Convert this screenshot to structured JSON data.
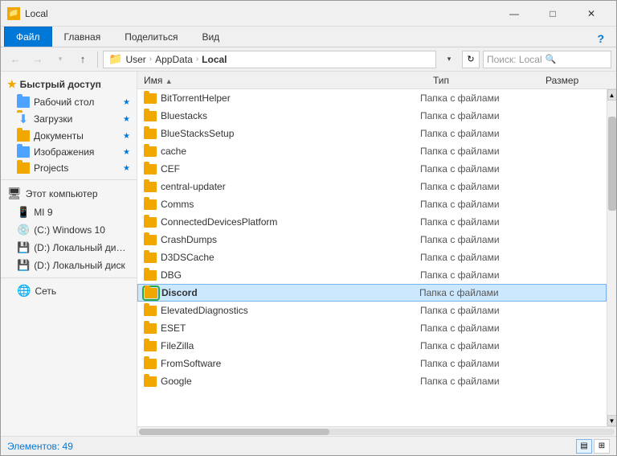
{
  "window": {
    "title": "Local",
    "title_icon": "📁"
  },
  "ribbon": {
    "tabs": [
      {
        "label": "Файл",
        "active": true
      },
      {
        "label": "Главная",
        "active": false
      },
      {
        "label": "Поделиться",
        "active": false
      },
      {
        "label": "Вид",
        "active": false
      }
    ]
  },
  "toolbar": {
    "back_label": "←",
    "forward_label": "→",
    "up_label": "↑",
    "refresh_label": "↺"
  },
  "address": {
    "crumbs": [
      "User",
      "AppData",
      "Local"
    ],
    "search_placeholder": "Поиск: Local"
  },
  "sidebar": {
    "quick_access_label": "Быстрый доступ",
    "items": [
      {
        "label": "Рабочий стол",
        "badge": "★"
      },
      {
        "label": "Загрузки",
        "badge": "↓"
      },
      {
        "label": "Документы",
        "badge": "★"
      },
      {
        "label": "Изображения",
        "badge": "★"
      },
      {
        "label": "Projects",
        "badge": "★"
      }
    ],
    "computer_label": "Этот компьютер",
    "drives": [
      {
        "label": "MI 9"
      },
      {
        "label": "(C:) Windows 10"
      },
      {
        "label": "(D:) Локальный ди…"
      },
      {
        "label": "(D:) Локальный диск"
      }
    ],
    "network_label": "Сеть"
  },
  "file_list": {
    "columns": {
      "name": "Имя",
      "type": "Тип",
      "size": "Размер"
    },
    "files": [
      {
        "name": "BitTorrentHelper",
        "type": "Папка с файлами",
        "size": ""
      },
      {
        "name": "Bluestacks",
        "type": "Папка с файлами",
        "size": ""
      },
      {
        "name": "BlueStacksSetup",
        "type": "Папка с файлами",
        "size": ""
      },
      {
        "name": "cache",
        "type": "Папка с файлами",
        "size": ""
      },
      {
        "name": "CEF",
        "type": "Папка с файлами",
        "size": ""
      },
      {
        "name": "central-updater",
        "type": "Папка с файлами",
        "size": ""
      },
      {
        "name": "Comms",
        "type": "Папка с файлами",
        "size": ""
      },
      {
        "name": "ConnectedDevicesPlatform",
        "type": "Папка с файлами",
        "size": ""
      },
      {
        "name": "CrashDumps",
        "type": "Папка с файлами",
        "size": ""
      },
      {
        "name": "D3DSCache",
        "type": "Папка с файлами",
        "size": ""
      },
      {
        "name": "DBG",
        "type": "Папка с файлами",
        "size": ""
      },
      {
        "name": "Discord",
        "type": "Папка с файлами",
        "size": "",
        "selected": true
      },
      {
        "name": "ElevatedDiagnostics",
        "type": "Папка с файлами",
        "size": ""
      },
      {
        "name": "ESET",
        "type": "Папка с файлами",
        "size": ""
      },
      {
        "name": "FileZilla",
        "type": "Папка с файлами",
        "size": ""
      },
      {
        "name": "FromSoftware",
        "type": "Папка с файлами",
        "size": ""
      },
      {
        "name": "Google",
        "type": "Папка с файлами",
        "size": ""
      }
    ]
  },
  "status": {
    "items_count": "Элементов: 49"
  },
  "title_controls": {
    "minimize": "—",
    "maximize": "□",
    "close": "✕"
  }
}
